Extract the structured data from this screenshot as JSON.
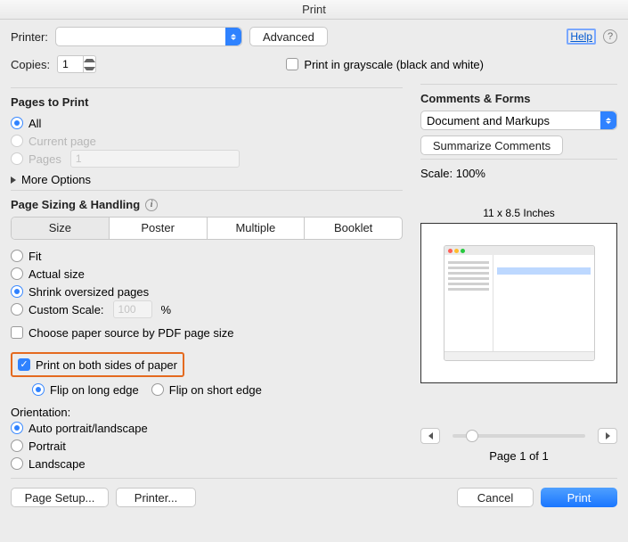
{
  "window": {
    "title": "Print"
  },
  "header": {
    "printer_label": "Printer:",
    "printer_value": "",
    "advanced": "Advanced",
    "help": "Help",
    "copies_label": "Copies:",
    "copies_value": "1",
    "grayscale": "Print in grayscale (black and white)"
  },
  "pages_to_print": {
    "title": "Pages to Print",
    "all": "All",
    "current_page": "Current page",
    "pages": "Pages",
    "pages_value": "1",
    "more_options": "More Options"
  },
  "sizing": {
    "title": "Page Sizing & Handling",
    "seg": {
      "size": "Size",
      "poster": "Poster",
      "multiple": "Multiple",
      "booklet": "Booklet"
    },
    "fit": "Fit",
    "actual_size": "Actual size",
    "shrink": "Shrink oversized pages",
    "custom_scale": "Custom Scale:",
    "custom_scale_value": "100",
    "percent": "%",
    "choose_paper": "Choose paper source by PDF page size",
    "both_sides": "Print on both sides of paper",
    "flip_long": "Flip on long edge",
    "flip_short": "Flip on short edge",
    "orientation": "Orientation:",
    "auto": "Auto portrait/landscape",
    "portrait": "Portrait",
    "landscape": "Landscape"
  },
  "comments": {
    "title": "Comments & Forms",
    "select_value": "Document and Markups",
    "summarize": "Summarize Comments"
  },
  "preview": {
    "scale_label": "Scale: 100%",
    "dims": "11 x 8.5 Inches",
    "page_of": "Page 1 of 1"
  },
  "footer": {
    "page_setup": "Page Setup...",
    "printer": "Printer...",
    "cancel": "Cancel",
    "print": "Print"
  }
}
